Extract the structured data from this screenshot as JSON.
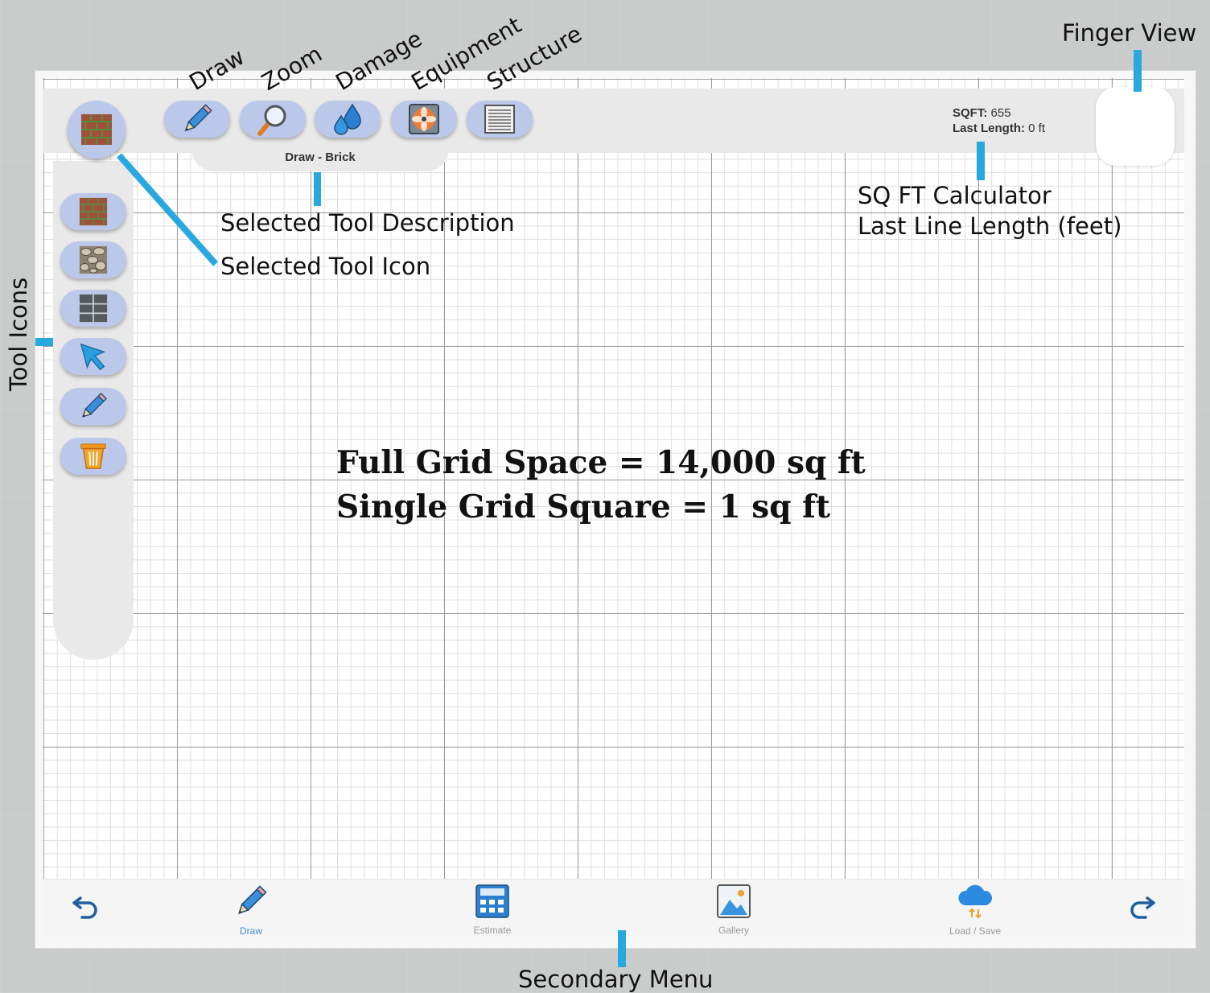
{
  "toolbar": {
    "selected_description": "Draw - Brick",
    "tools": [
      {
        "label": "Draw",
        "icon": "pencil-icon"
      },
      {
        "label": "Zoom",
        "icon": "magnifier-icon"
      },
      {
        "label": "Damage",
        "icon": "water-drops-icon"
      },
      {
        "label": "Equipment",
        "icon": "fan-icon"
      },
      {
        "label": "Structure",
        "icon": "structure-lines-icon"
      }
    ]
  },
  "sidebar": {
    "selected_icon": "brick-icon",
    "items": [
      {
        "icon": "brick-icon"
      },
      {
        "icon": "stone-icon"
      },
      {
        "icon": "tile-grid-icon"
      },
      {
        "icon": "cursor-arrow-icon"
      },
      {
        "icon": "pencil-icon"
      },
      {
        "icon": "trash-icon"
      }
    ]
  },
  "stats": {
    "sqft_label": "SQFT:",
    "sqft_value": "655",
    "length_label": "Last Length:",
    "length_value": "0 ft"
  },
  "canvas_text": {
    "line1": "Full Grid Space = 14,000 sq ft",
    "line2": "Single Grid Square = 1 sq ft"
  },
  "bottom_nav": {
    "undo_icon": "undo-icon",
    "redo_icon": "redo-icon",
    "items": [
      {
        "label": "Draw",
        "icon": "pencil-icon",
        "active": true
      },
      {
        "label": "Estimate",
        "icon": "calculator-icon",
        "active": false
      },
      {
        "label": "Gallery",
        "icon": "gallery-icon",
        "active": false
      },
      {
        "label": "Load / Save",
        "icon": "cloud-icon",
        "active": false
      }
    ]
  },
  "annotations": {
    "draw": "Draw",
    "zoom": "Zoom",
    "damage": "Damage",
    "equipment": "Equipment",
    "structure": "Structure",
    "finger_view": "Finger View",
    "selected_tool_description": "Selected Tool Description",
    "selected_tool_icon": "Selected Tool Icon",
    "sqft_calculator": "SQ FT Calculator",
    "last_line_length": "Last Line Length (feet)",
    "tool_icons": "Tool Icons",
    "secondary_menu": "Secondary Menu"
  },
  "colors": {
    "accent": "#29a8e0",
    "button_fill": "#bcc8ea",
    "active_nav": "#3c8fe0"
  }
}
